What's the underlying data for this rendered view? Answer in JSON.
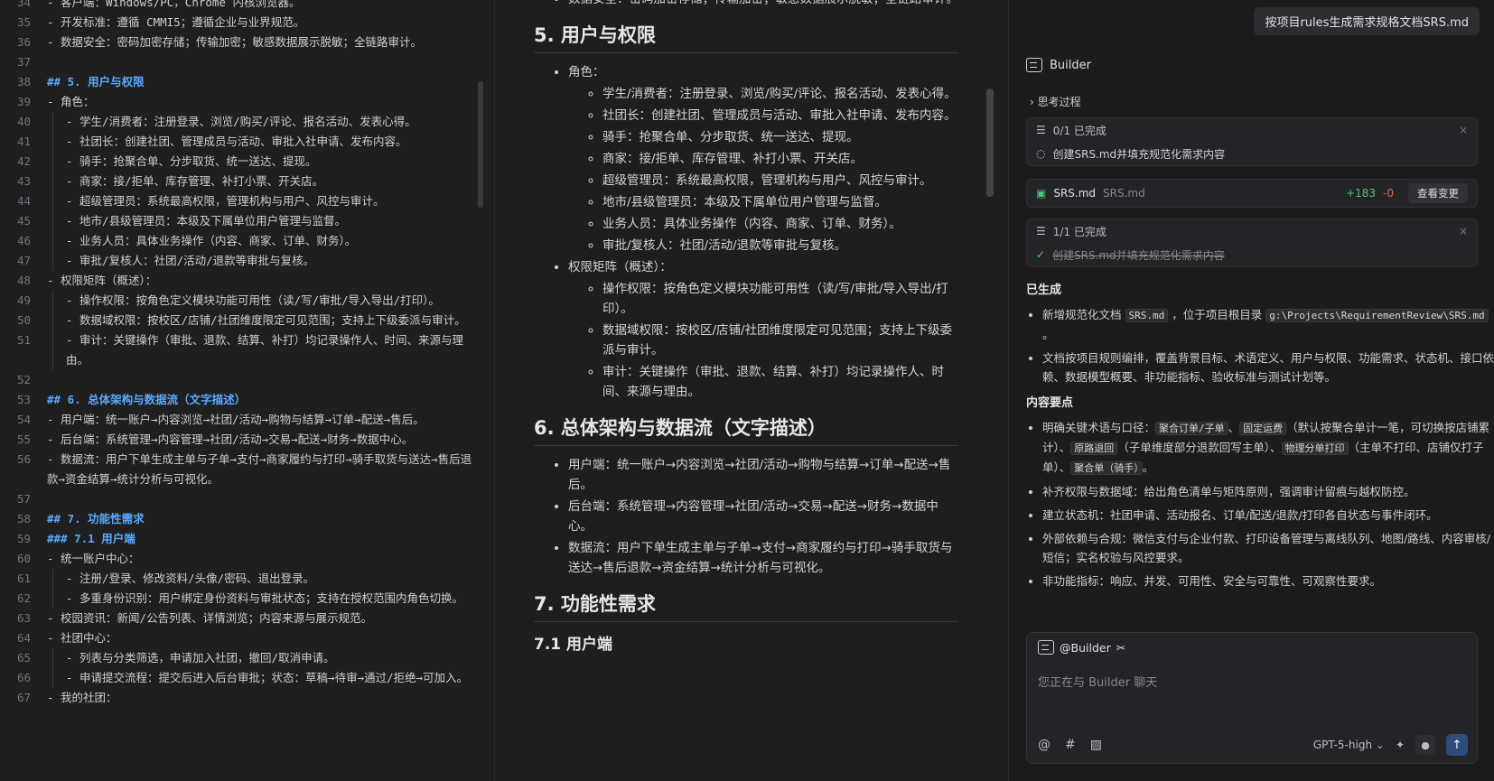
{
  "editor": {
    "lines": [
      {
        "n": "34",
        "t": "- 客户端：Windows/PC，Chrome 内核浏览器。",
        "cls": ""
      },
      {
        "n": "35",
        "t": "- 开发标准：遵循 CMMI5；遵循企业与业界规范。",
        "cls": ""
      },
      {
        "n": "36",
        "t": "- 数据安全：密码加密存储；传输加密；敏感数据展示脱敏；全链路审计。",
        "cls": ""
      },
      {
        "n": "37",
        "t": "",
        "cls": ""
      },
      {
        "n": "38",
        "t": "## 5. 用户与权限",
        "cls": "h"
      },
      {
        "n": "39",
        "t": "- 角色：",
        "cls": ""
      },
      {
        "n": "40",
        "t": "- 学生/消费者：注册登录、浏览/购买/评论、报名活动、发表心得。",
        "cls": "i1"
      },
      {
        "n": "41",
        "t": "- 社团长：创建社团、管理成员与活动、审批入社申请、发布内容。",
        "cls": "i1"
      },
      {
        "n": "42",
        "t": "- 骑手：抢聚合单、分步取货、统一送达、提现。",
        "cls": "i1"
      },
      {
        "n": "43",
        "t": "- 商家：接/拒单、库存管理、补打小票、开关店。",
        "cls": "i1"
      },
      {
        "n": "44",
        "t": "- 超级管理员：系统最高权限，管理机构与用户、风控与审计。",
        "cls": "i1"
      },
      {
        "n": "45",
        "t": "- 地市/县级管理员：本级及下属单位用户管理与监督。",
        "cls": "i1"
      },
      {
        "n": "46",
        "t": "- 业务人员：具体业务操作（内容、商家、订单、财务）。",
        "cls": "i1"
      },
      {
        "n": "47",
        "t": "- 审批/复核人：社团/活动/退款等审批与复核。",
        "cls": "i1"
      },
      {
        "n": "48",
        "t": "- 权限矩阵（概述）：",
        "cls": ""
      },
      {
        "n": "49",
        "t": "- 操作权限：按角色定义模块功能可用性（读/写/审批/导入导出/打印）。",
        "cls": "i1"
      },
      {
        "n": "50",
        "t": "- 数据域权限：按校区/店铺/社团维度限定可见范围；支持上下级委派与审计。",
        "cls": "i1"
      },
      {
        "n": "51",
        "t": "- 审计：关键操作（审批、退款、结算、补打）均记录操作人、时间、来源与理由。",
        "cls": "i1"
      },
      {
        "n": "52",
        "t": "",
        "cls": ""
      },
      {
        "n": "53",
        "t": "## 6. 总体架构与数据流（文字描述）",
        "cls": "h"
      },
      {
        "n": "54",
        "t": "- 用户端：统一账户→内容浏览→社团/活动→购物与结算→订单→配送→售后。",
        "cls": ""
      },
      {
        "n": "55",
        "t": "- 后台端：系统管理→内容管理→社团/活动→交易→配送→财务→数据中心。",
        "cls": ""
      },
      {
        "n": "56",
        "t": "- 数据流：用户下单生成主单与子单→支付→商家履约与打印→骑手取货与送达→售后退款→资金结算→统计分析与可视化。",
        "cls": ""
      },
      {
        "n": "57",
        "t": "",
        "cls": ""
      },
      {
        "n": "58",
        "t": "## 7. 功能性需求",
        "cls": "h"
      },
      {
        "n": "59",
        "t": "### 7.1 用户端",
        "cls": "h"
      },
      {
        "n": "60",
        "t": "- 统一账户中心：",
        "cls": ""
      },
      {
        "n": "61",
        "t": "- 注册/登录、修改资料/头像/密码、退出登录。",
        "cls": "i1"
      },
      {
        "n": "62",
        "t": "- 多重身份识别：用户绑定身份资料与审批状态；支持在授权范围内角色切换。",
        "cls": "i1"
      },
      {
        "n": "63",
        "t": "- 校园资讯：新闻/公告列表、详情浏览；内容来源与展示规范。",
        "cls": ""
      },
      {
        "n": "64",
        "t": "- 社团中心：",
        "cls": ""
      },
      {
        "n": "65",
        "t": "- 列表与分类筛选，申请加入社团，撤回/取消申请。",
        "cls": "i1"
      },
      {
        "n": "66",
        "t": "- 申请提交流程：提交后进入后台审批；状态：草稿→待审→通过/拒绝→可加入。",
        "cls": "i1"
      },
      {
        "n": "67",
        "t": "- 我的社团：",
        "cls": ""
      }
    ]
  },
  "preview": {
    "top_text": "数据安全：密码加密存储；传输加密；敏感数据展示脱敏；全链路审计。",
    "h5": "5. 用户与权限",
    "roles_label": "角色：",
    "roles": [
      "学生/消费者：注册登录、浏览/购买/评论、报名活动、发表心得。",
      "社团长：创建社团、管理成员与活动、审批入社申请、发布内容。",
      "骑手：抢聚合单、分步取货、统一送达、提现。",
      "商家：接/拒单、库存管理、补打小票、开关店。",
      "超级管理员：系统最高权限，管理机构与用户、风控与审计。",
      "地市/县级管理员：本级及下属单位用户管理与监督。",
      "业务人员：具体业务操作（内容、商家、订单、财务）。",
      "审批/复核人：社团/活动/退款等审批与复核。"
    ],
    "matrix_label": "权限矩阵（概述）：",
    "matrix": [
      "操作权限：按角色定义模块功能可用性（读/写/审批/导入导出/打印）。",
      "数据域权限：按校区/店铺/社团维度限定可见范围；支持上下级委派与审计。",
      "审计：关键操作（审批、退款、结算、补打）均记录操作人、时间、来源与理由。"
    ],
    "h6": "6. 总体架构与数据流（文字描述）",
    "arch": [
      "用户端：统一账户→内容浏览→社团/活动→购物与结算→订单→配送→售后。",
      "后台端：系统管理→内容管理→社团/活动→交易→配送→财务→数据中心。",
      "数据流：用户下单生成主单与子单→支付→商家履约与打印→骑手取货与送达→售后退款→资金结算→统计分析与可视化。"
    ],
    "h7": "7. 功能性需求",
    "h71": "7.1 用户端"
  },
  "chat": {
    "user_message": "按项目rules生成需求规格文档SRS.md",
    "undo_icon": "undo-icon",
    "agent_name": "Builder",
    "thinking_label": "思考过程",
    "task1_progress": "0/1 已完成",
    "task1_item": "创建SRS.md并填充规范化需求内容",
    "file_name": "SRS.md",
    "file_path": "SRS.md",
    "added": "+183",
    "removed": "-0",
    "view_changes": "查看变更",
    "task2_progress": "1/1 已完成",
    "task2_item": "创建SRS.md并填充规范化需求内容",
    "generated_title": "已生成",
    "gen1_a": "新增规范化文档",
    "gen1_code1": "SRS.md",
    "gen1_b": "，位于项目根目录",
    "gen1_code2": "g:\\Projects\\RequirementReview\\SRS.md",
    "gen1_c": "。",
    "gen2": "文档按项目规则编排，覆盖背景目标、术语定义、用户与权限、功能需求、状态机、接口依赖、数据模型概要、非功能指标、验收标准与测试计划等。",
    "points_title": "内容要点",
    "p1_a": "明确关键术语与口径：",
    "p1_c1": "聚合订单/子单",
    "p1_b": "、",
    "p1_c2": "固定运费",
    "p1_c": "（默认按聚合单计一笔，可切换按店铺累计）、",
    "p1_c3": "原路退回",
    "p1_d": "（子单维度部分退款回写主单）、",
    "p1_c4": "物理分单打印",
    "p1_e": "（主单不打印、店铺仅打子单）、",
    "p1_c5": "聚合单（骑手）",
    "p1_f": "。",
    "p2": "补齐权限与数据域：给出角色清单与矩阵原则，强调审计留痕与越权防控。",
    "p3": "建立状态机：社团申请、活动报名、订单/配送/退款/打印各自状态与事件闭环。",
    "p4": "外部依赖与合规：微信支付与企业付款、打印设备管理与离线队列、地图/路线、内容审核/短信；实名校验与风控要求。",
    "p5": "非功能指标：响应、并发、可用性、安全与可靠性、可观察性要求。",
    "mention": "@Builder",
    "input_placeholder": "您正在与 Builder 聊天",
    "model": "GPT-5-high"
  }
}
